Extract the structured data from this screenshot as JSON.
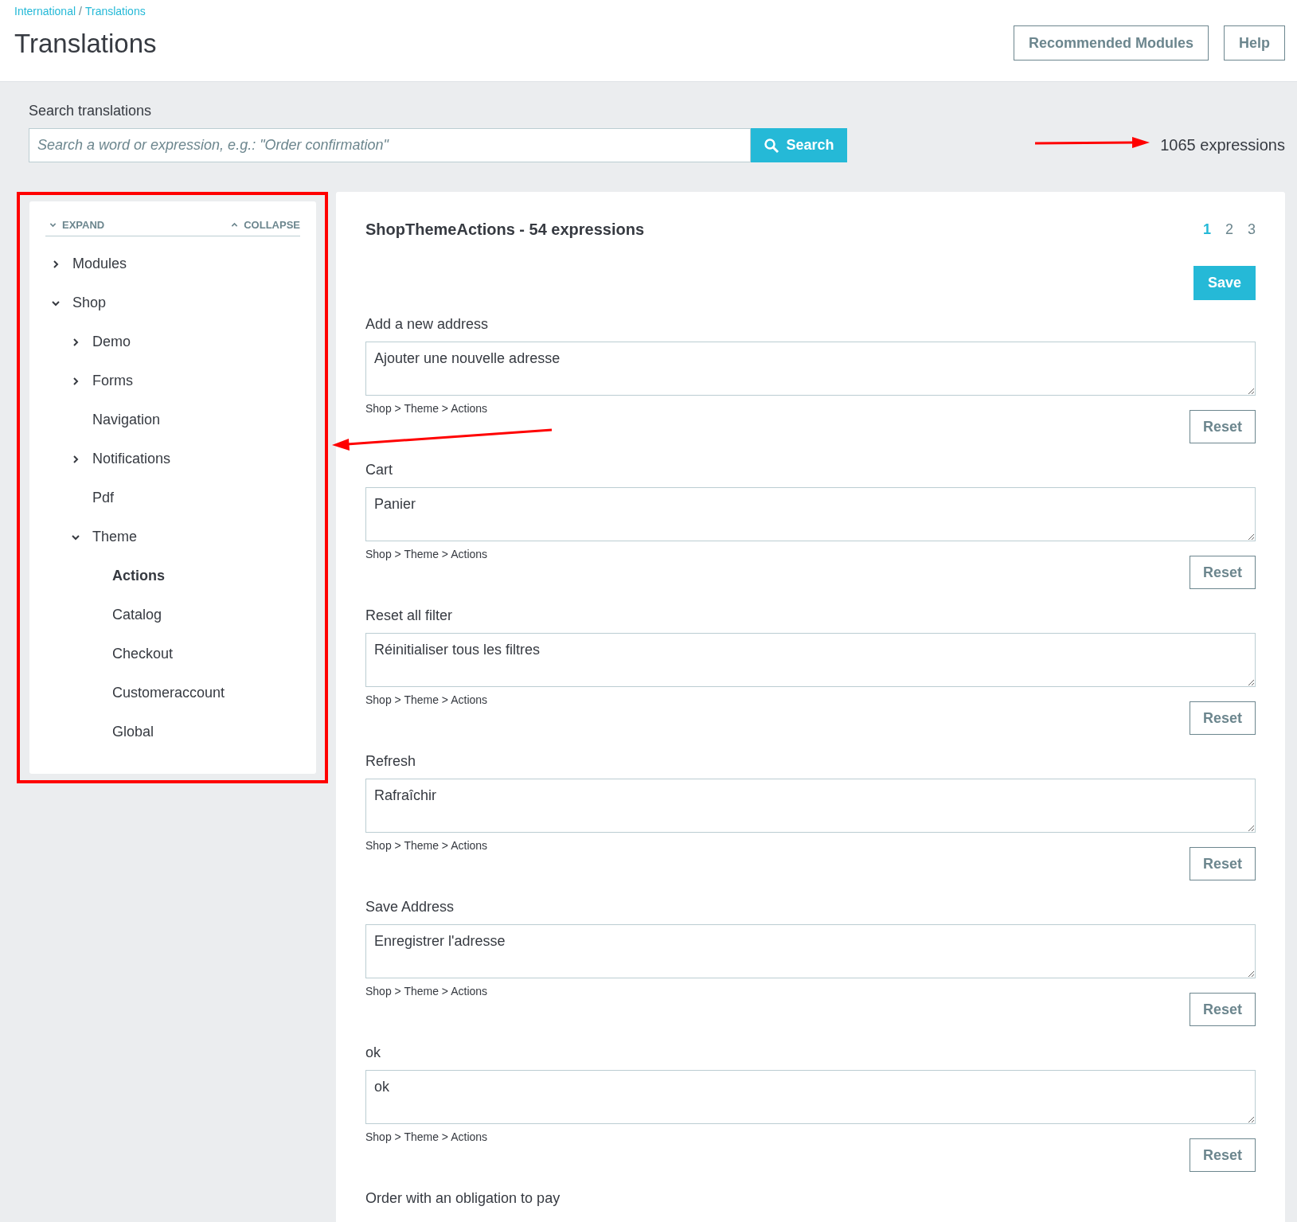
{
  "breadcrumb": [
    {
      "label": "International"
    },
    {
      "label": "Translations"
    }
  ],
  "breadcrumb_separator": "/",
  "title": "Translations",
  "header_buttons": [
    "Recommended Modules",
    "Help"
  ],
  "search": {
    "label": "Search translations",
    "placeholder": "Search a word or expression, e.g.: \"Order confirmation\"",
    "button": "Search"
  },
  "expression_count": "1065 expressions",
  "tree_controls": {
    "expand": "EXPAND",
    "collapse": "COLLAPSE"
  },
  "tree": [
    {
      "label": "Modules",
      "kind": "folder",
      "expanded": false,
      "selected": false
    },
    {
      "label": "Shop",
      "kind": "folder",
      "expanded": true,
      "selected": false,
      "children": [
        {
          "label": "Demo",
          "kind": "folder",
          "expanded": false,
          "selected": false
        },
        {
          "label": "Forms",
          "kind": "folder",
          "expanded": false,
          "selected": false
        },
        {
          "label": "Navigation",
          "kind": "leaf",
          "selected": false
        },
        {
          "label": "Notifications",
          "kind": "folder",
          "expanded": false,
          "selected": false
        },
        {
          "label": "Pdf",
          "kind": "leaf",
          "selected": false
        },
        {
          "label": "Theme",
          "kind": "folder",
          "expanded": true,
          "selected": false,
          "children": [
            {
              "label": "Actions",
              "kind": "leaf",
              "selected": true
            },
            {
              "label": "Catalog",
              "kind": "leaf",
              "selected": false
            },
            {
              "label": "Checkout",
              "kind": "leaf",
              "selected": false
            },
            {
              "label": "Customeraccount",
              "kind": "leaf",
              "selected": false
            },
            {
              "label": "Global",
              "kind": "leaf",
              "selected": false
            }
          ]
        }
      ]
    }
  ],
  "section": {
    "title": "ShopThemeActions - 54 expressions",
    "pages": [
      {
        "label": "1",
        "selected": true
      },
      {
        "label": "2",
        "selected": false
      },
      {
        "label": "3",
        "selected": false
      }
    ],
    "save": "Save"
  },
  "entries": [
    {
      "label": "Add a new address",
      "value": "Ajouter une nouvelle adresse",
      "path": "Shop > Theme > Actions",
      "reset": "Reset"
    },
    {
      "label": "Cart",
      "value": "Panier",
      "path": "Shop > Theme > Actions",
      "reset": "Reset"
    },
    {
      "label": "Reset all filter",
      "value": "Réinitialiser tous les filtres",
      "path": "Shop > Theme > Actions",
      "reset": "Reset"
    },
    {
      "label": "Refresh",
      "value": "Rafraîchir",
      "path": "Shop > Theme > Actions",
      "reset": "Reset"
    },
    {
      "label": "Save Address",
      "value": "Enregistrer l'adresse",
      "path": "Shop > Theme > Actions",
      "reset": "Reset"
    },
    {
      "label": "ok",
      "value": "ok",
      "path": "Shop > Theme > Actions",
      "reset": "Reset"
    },
    {
      "label": "Order with an obligation to pay"
    }
  ]
}
